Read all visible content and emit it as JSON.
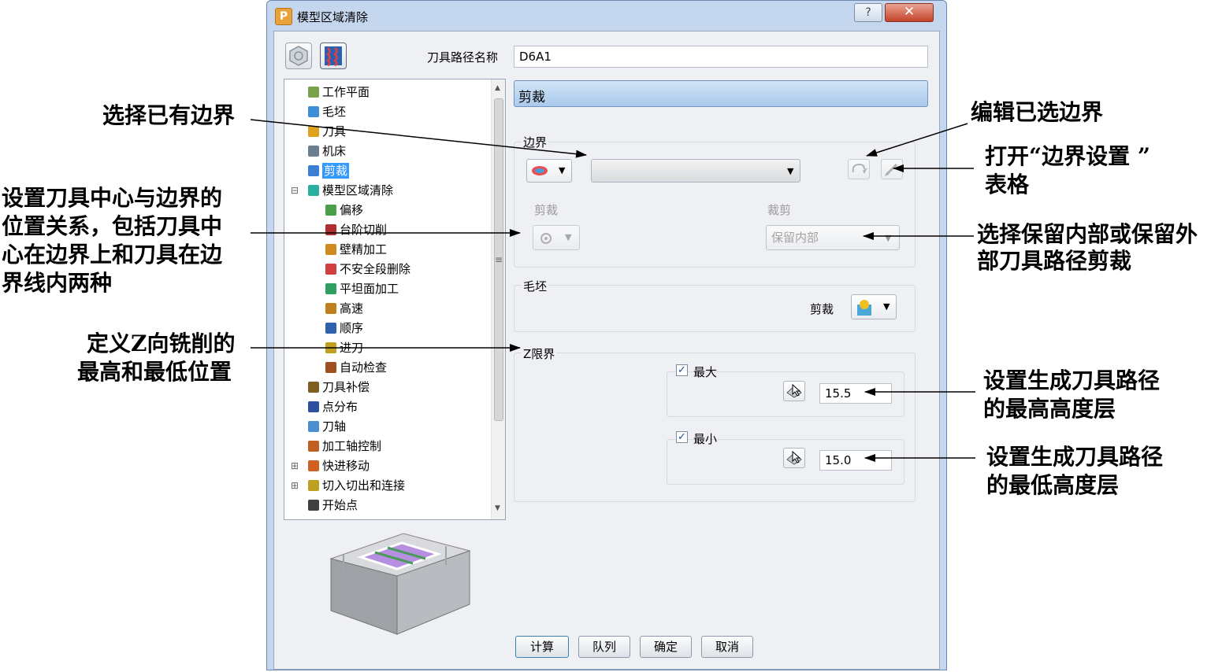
{
  "window": {
    "title": "模型区域清除",
    "help_glyph": "?",
    "close_glyph": "✕",
    "app_icon_letter": "P"
  },
  "path_name": {
    "label": "刀具路径名称",
    "value": "D6A1"
  },
  "tree": {
    "items": [
      {
        "label": "工作平面",
        "icon": "workplane-icon",
        "color": "#7aa24a"
      },
      {
        "label": "毛坯",
        "icon": "block-icon",
        "color": "#3d8fd8"
      },
      {
        "label": "刀具",
        "icon": "tool-icon",
        "color": "#e0a020"
      },
      {
        "label": "机床",
        "icon": "machine-icon",
        "color": "#6b7d91"
      },
      {
        "label": "剪裁",
        "icon": "limit-icon",
        "color": "#3a7ed6",
        "selected": true
      },
      {
        "label": "模型区域清除",
        "icon": "area-clear-icon",
        "color": "#2ab0a0"
      },
      {
        "label": "偏移",
        "icon": "offset-icon",
        "color": "#4aa04a"
      },
      {
        "label": "台阶切削",
        "icon": "step-cut-icon",
        "color": "#b03030"
      },
      {
        "label": "壁精加工",
        "icon": "wall-finish-icon",
        "color": "#d08a20"
      },
      {
        "label": "不安全段删除",
        "icon": "unsafe-remove-icon",
        "color": "#d04040"
      },
      {
        "label": "平坦面加工",
        "icon": "flat-machine-icon",
        "color": "#30a060"
      },
      {
        "label": "高速",
        "icon": "high-speed-icon",
        "color": "#c08020"
      },
      {
        "label": "顺序",
        "icon": "order-icon",
        "color": "#3060b0"
      },
      {
        "label": "进刀",
        "icon": "plunge-icon",
        "color": "#c0a020"
      },
      {
        "label": "自动检查",
        "icon": "auto-check-icon",
        "color": "#a05020"
      },
      {
        "label": "刀具补偿",
        "icon": "tool-comp-icon",
        "color": "#806020"
      },
      {
        "label": "点分布",
        "icon": "point-dist-icon",
        "color": "#3050a0"
      },
      {
        "label": "刀轴",
        "icon": "tool-axis-icon",
        "color": "#4a90d0"
      },
      {
        "label": "加工轴控制",
        "icon": "axis-control-icon",
        "color": "#c06020"
      },
      {
        "label": "快进移动",
        "icon": "rapid-move-icon",
        "color": "#d06020"
      },
      {
        "label": "切入切出和连接",
        "icon": "lead-link-icon",
        "color": "#c0a020"
      },
      {
        "label": "开始点",
        "icon": "start-point-icon",
        "color": "#404040"
      }
    ]
  },
  "panel": {
    "header": "剪裁",
    "boundary": {
      "label": "边界",
      "value": ""
    },
    "trim_label": "剪裁",
    "cut_label": "裁剪",
    "cut_value": "保留内部",
    "stock": {
      "label": "毛坯",
      "trim_label": "剪裁"
    },
    "zlimit": {
      "label": "Z限界",
      "max": {
        "label": "最大",
        "value": "15.5",
        "checked": true
      },
      "min": {
        "label": "最小",
        "value": "15.0",
        "checked": true
      }
    }
  },
  "buttons": {
    "calculate": "计算",
    "queue": "队列",
    "ok": "确定",
    "cancel": "取消"
  },
  "annotations": {
    "select_boundary": "选择已有边界",
    "tool_center_1": "设置刀具中心与边界的",
    "tool_center_2": "位置关系，包括刀具中",
    "tool_center_3": "心在边界上和刀具在边",
    "tool_center_4": "界线内两种",
    "z_def_1": "定义Z向铣削的",
    "z_def_2": "最高和最低位置",
    "edit_boundary": "编辑已选边界",
    "open_settings_1": "打开“边界设置 ”",
    "open_settings_2": "表格",
    "keep_1": "选择保留内部或保留外",
    "keep_2": "部刀具路径剪裁",
    "max_layer_1": "设置生成刀具路径",
    "max_layer_2": "的最高高度层",
    "min_layer_1": "设置生成刀具路径",
    "min_layer_2": "的最低高度层"
  },
  "colors": {
    "header_bg": "#b8d4f0",
    "selection": "#3399ff",
    "title_bar": "#c5d7ee"
  }
}
